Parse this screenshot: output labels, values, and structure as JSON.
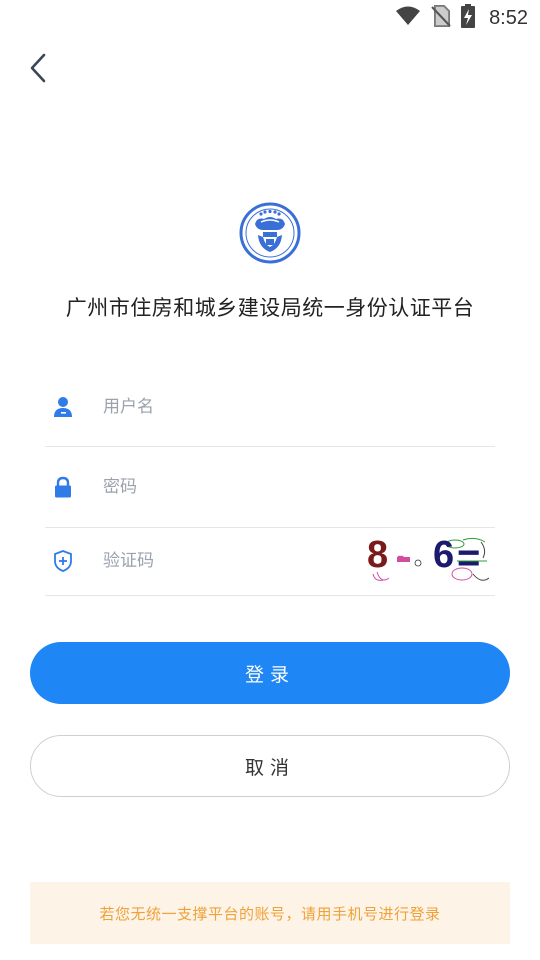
{
  "status_bar": {
    "time": "8:52",
    "icons": [
      "wifi-icon",
      "no-sim-icon",
      "battery-charging-icon"
    ]
  },
  "header": {
    "back_icon": "chevron-left-icon"
  },
  "main": {
    "logo": "department-emblem",
    "title": "广州市住房和城乡建设局统一身份认证平台"
  },
  "form": {
    "username": {
      "icon": "user-icon",
      "placeholder": "用户名",
      "value": ""
    },
    "password": {
      "icon": "lock-icon",
      "placeholder": "密码",
      "value": ""
    },
    "captcha": {
      "icon": "shield-plus-icon",
      "placeholder": "验证码",
      "value": "",
      "image_text": {
        "first": "8",
        "operator": "-",
        "second": "6",
        "equals": "="
      }
    }
  },
  "actions": {
    "login_label": "登录",
    "cancel_label": "取消"
  },
  "notice": {
    "text": "若您无统一支撑平台的账号，请用手机号进行登录"
  },
  "colors": {
    "primary": "#1e87f5",
    "icon_blue": "#2f7be8",
    "logo_blue": "#3a6fd8",
    "notice_bg": "#fdf3e6",
    "notice_text": "#f0a23a",
    "captcha_first": "#7a1a1a",
    "captcha_second": "#1d1a6e"
  }
}
